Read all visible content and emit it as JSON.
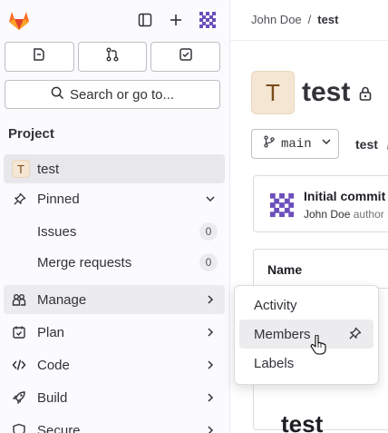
{
  "header": {
    "logo_icon": "gitlab-tanuki-icon",
    "sidebar_toggle_icon": "sidebar-toggle-icon",
    "new_icon": "plus-icon",
    "user_icon": "user-avatar-icon"
  },
  "quick_actions": {
    "items": [
      {
        "icon": "issues-icon"
      },
      {
        "icon": "merge-request-icon"
      },
      {
        "icon": "todo-icon"
      }
    ]
  },
  "search": {
    "label": "Search or go to...",
    "icon": "search-icon"
  },
  "sidebar": {
    "section_title": "Project",
    "project": {
      "avatar_letter": "T",
      "name": "test"
    },
    "pinned": {
      "label": "Pinned",
      "icon": "thumbtack-icon",
      "items": [
        {
          "label": "Issues",
          "count": "0"
        },
        {
          "label": "Merge requests",
          "count": "0"
        }
      ]
    },
    "items": [
      {
        "label": "Manage",
        "icon": "users-icon"
      },
      {
        "label": "Plan",
        "icon": "planning-icon"
      },
      {
        "label": "Code",
        "icon": "code-icon"
      },
      {
        "label": "Build",
        "icon": "rocket-icon"
      },
      {
        "label": "Secure",
        "icon": "shield-icon"
      }
    ]
  },
  "breadcrumb": {
    "parent": "John Doe",
    "separator": "/",
    "current": "test"
  },
  "project": {
    "avatar_letter": "T",
    "title": "test",
    "lock_icon": "lock-icon",
    "branch": "main",
    "path_label": "test",
    "path_sep": "/"
  },
  "commit": {
    "title": "Initial commit",
    "author": "John Doe",
    "suffix": "author"
  },
  "file_table": {
    "column_name": "Name"
  },
  "readme": {
    "title": "test"
  },
  "flyout": {
    "items": [
      {
        "label": "Activity"
      },
      {
        "label": "Members"
      },
      {
        "label": "Labels"
      }
    ]
  },
  "colors": {
    "active_indicator": "#1f75cb",
    "avatar_bg": "#f5e6d3",
    "logo_orange": "#e24329"
  }
}
